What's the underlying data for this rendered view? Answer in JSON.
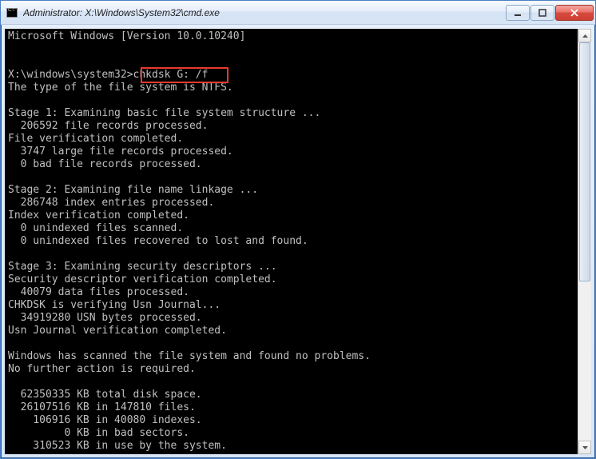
{
  "titlebar": {
    "icon_label": "cmd-icon",
    "title": "Administrator: X:\\Windows\\System32\\cmd.exe"
  },
  "window_controls": {
    "minimize": "Minimize",
    "maximize": "Maximize",
    "close": "Close"
  },
  "highlight": {
    "command": "chkdsk G: /f"
  },
  "terminal": {
    "lines": [
      "Microsoft Windows [Version 10.0.10240]",
      "",
      "",
      "X:\\windows\\system32>chkdsk G: /f",
      "The type of the file system is NTFS.",
      "",
      "Stage 1: Examining basic file system structure ...",
      "  206592 file records processed.",
      "File verification completed.",
      "  3747 large file records processed.",
      "  0 bad file records processed.",
      "",
      "Stage 2: Examining file name linkage ...",
      "  286748 index entries processed.",
      "Index verification completed.",
      "  0 unindexed files scanned.",
      "  0 unindexed files recovered to lost and found.",
      "",
      "Stage 3: Examining security descriptors ...",
      "Security descriptor verification completed.",
      "  40079 data files processed.",
      "CHKDSK is verifying Usn Journal...",
      "  34919280 USN bytes processed.",
      "Usn Journal verification completed.",
      "",
      "Windows has scanned the file system and found no problems.",
      "No further action is required.",
      "",
      "  62350335 KB total disk space.",
      "  26107516 KB in 147810 files.",
      "    106916 KB in 40080 indexes.",
      "         0 KB in bad sectors.",
      "    310523 KB in use by the system."
    ]
  }
}
